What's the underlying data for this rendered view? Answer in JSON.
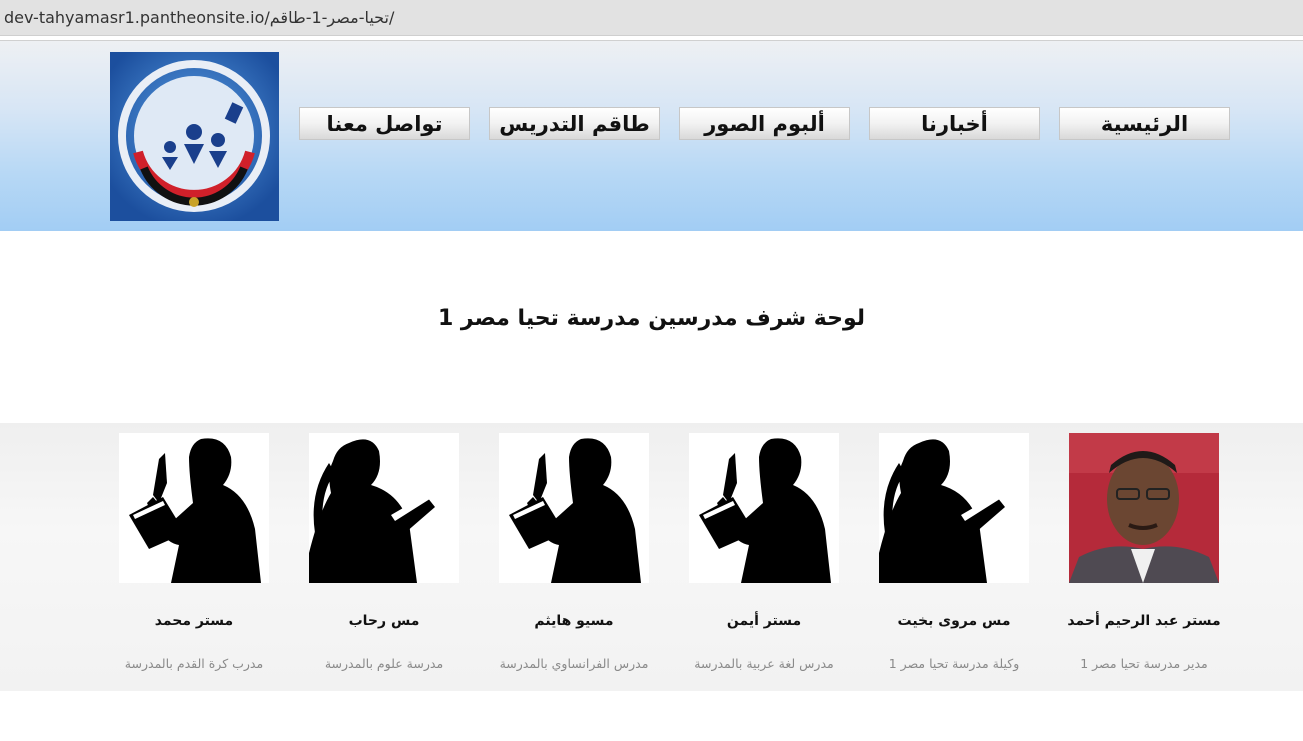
{
  "browser": {
    "url": "dev-tahyamasr1.pantheonsite.io/تحيا-مصر-1-طاقم/"
  },
  "header": {
    "logo_icon": "school-logo",
    "nav": [
      {
        "label": "الرئيسية"
      },
      {
        "label": "أخبارنا"
      },
      {
        "label": "ألبوم الصور"
      },
      {
        "label": "طاقم التدريس"
      },
      {
        "label": "تواصل معنا"
      }
    ]
  },
  "main": {
    "title": "لوحة شرف مدرسين مدرسة تحيا مصر 1"
  },
  "staff": [
    {
      "name": "مستر عبد الرحيم أحمد",
      "role": "مدير مدرسة تحيا مصر 1",
      "photo": "portrait-photo"
    },
    {
      "name": "مس مروى بخيت",
      "role": "وكيلة مدرسة تحيا مصر 1",
      "photo": "female-silhouette-icon"
    },
    {
      "name": "مستر أيمن",
      "role": "مدرس لغة عربية بالمدرسة",
      "photo": "male-silhouette-icon"
    },
    {
      "name": "مسيو هايثم",
      "role": "مدرس الفرانساوي بالمدرسة",
      "photo": "male-silhouette-icon"
    },
    {
      "name": "مس رحاب",
      "role": "مدرسة علوم بالمدرسة",
      "photo": "female-silhouette-icon"
    },
    {
      "name": "مستر محمد",
      "role": "مدرب كرة القدم بالمدرسة",
      "photo": "male-silhouette-icon"
    }
  ]
}
